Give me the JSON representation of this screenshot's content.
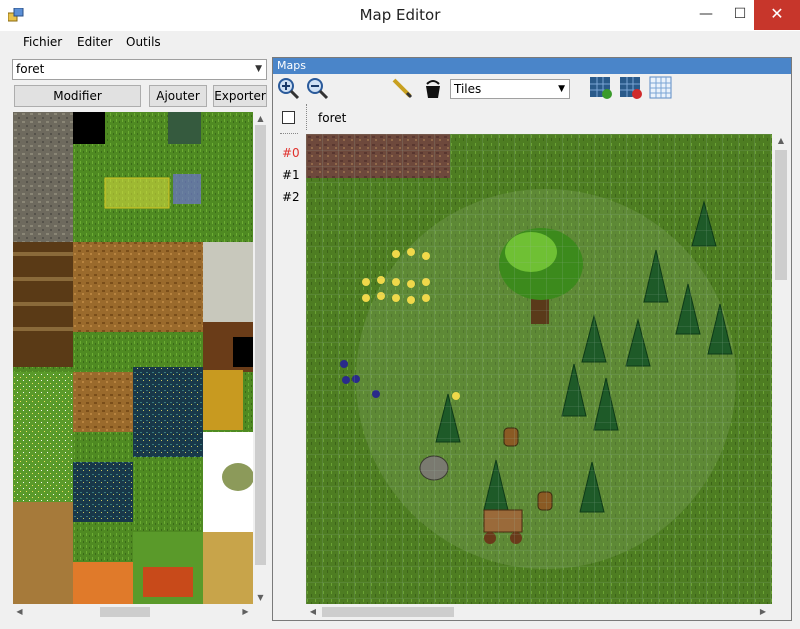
{
  "window": {
    "title": "Map Editor",
    "minimize": "—",
    "maximize": "☐",
    "close": "✕"
  },
  "menu": {
    "items": [
      "Fichier",
      "Editer",
      "Outils"
    ]
  },
  "tileset_panel": {
    "selected_map": "foret",
    "buttons": {
      "modifier": "Modifier",
      "ajouter": "Ajouter",
      "exporter": "Exporter"
    },
    "scroll_up": "▲",
    "scroll_down": "▼",
    "scroll_left": "◀",
    "scroll_right": "▶"
  },
  "maps_panel": {
    "header": "Maps",
    "layer_mode": "Tiles",
    "layers": [
      "#0",
      "#1",
      "#2"
    ],
    "active_layer": "#0",
    "map_name": "foret",
    "icons": [
      "zoom-in-icon",
      "zoom-out-icon",
      "pencil-icon",
      "bucket-icon",
      "grid-add-icon",
      "grid-remove-icon",
      "grid-toggle-icon"
    ]
  },
  "colors": {
    "accent": "#4a85c9",
    "close": "#c7362b",
    "active_layer": "#e0302c",
    "grass": "#4e7d22"
  }
}
